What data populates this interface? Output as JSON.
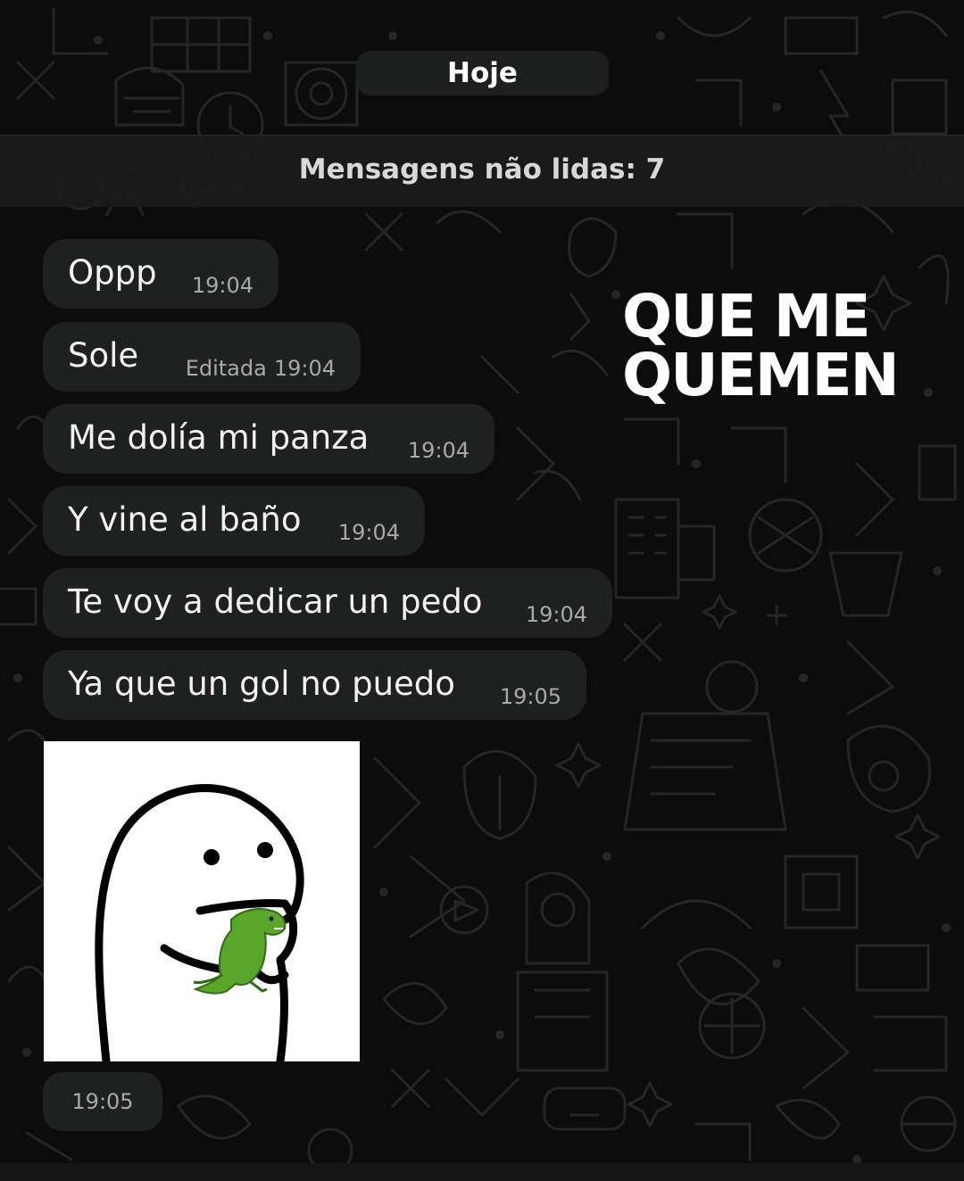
{
  "chat": {
    "date_label": "Hoje",
    "unread_label": "Mensagens não lidas: 7",
    "messages": [
      {
        "text": "Oppp",
        "time": "19:04",
        "edited": ""
      },
      {
        "text": "Sole",
        "time": "19:04",
        "edited": "Editada"
      },
      {
        "text": "Me dolía mi panza",
        "time": "19:04",
        "edited": ""
      },
      {
        "text": "Y vine al baño",
        "time": "19:04",
        "edited": ""
      },
      {
        "text": "Te voy a dedicar un pedo",
        "time": "19:04",
        "edited": ""
      },
      {
        "text": "Ya que un gol no puedo",
        "time": "19:05",
        "edited": ""
      }
    ],
    "sticker": {
      "icon": "blob-character-hugging-dinosaur-sticker",
      "time": "19:05"
    }
  },
  "overlay": {
    "line1": "QUE ME",
    "line2": "QUEMEN"
  },
  "colors": {
    "background": "#0c0c0c",
    "bubble": "#1f2020",
    "text": "#f2f2f2",
    "time": "#a9a9a9",
    "dino": "#5aa62a"
  }
}
